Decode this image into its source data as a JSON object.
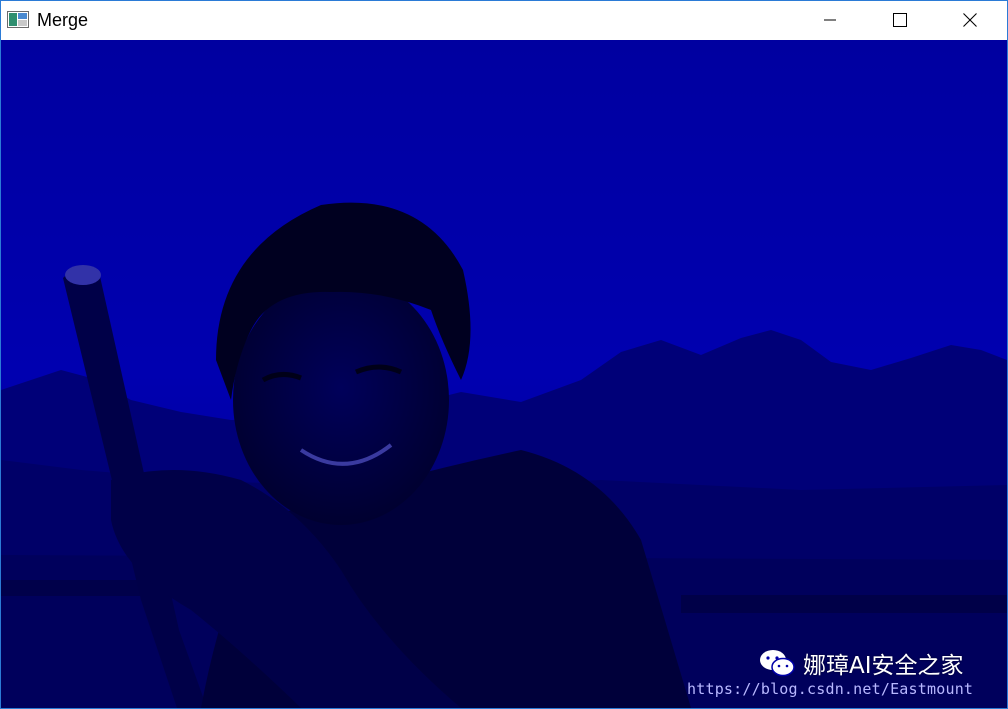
{
  "window": {
    "title": "Merge",
    "controls": {
      "minimize": "minimize",
      "maximize": "maximize",
      "close": "close"
    }
  },
  "image": {
    "description_color": "#0000a8",
    "watermark": {
      "brand": "娜璋AI安全之家",
      "url": "https://blog.csdn.net/Eastmount",
      "icon": "wechat-icon"
    }
  },
  "colors": {
    "border": "#2b7bd6",
    "image_bg": "#0000a8"
  }
}
